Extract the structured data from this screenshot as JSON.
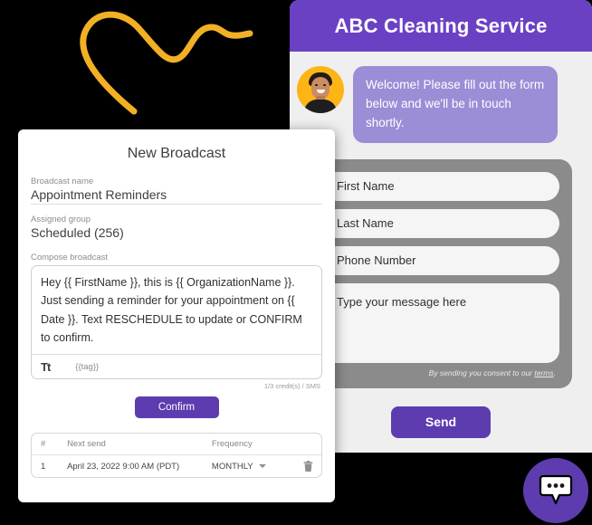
{
  "decor": {
    "squiggle_color": "#F2B024"
  },
  "chat_widget": {
    "header_title": "ABC Cleaning Service",
    "header_color": "#6B41C4",
    "welcome_message": "Welcome! Please fill out the form below and we'll be in touch shortly.",
    "bubble_color": "#9D8CD6",
    "avatar_bg": "#FDB515",
    "form": {
      "container_color": "#8B8B8B",
      "fields": [
        {
          "name": "first-name",
          "placeholder": "First Name"
        },
        {
          "name": "last-name",
          "placeholder": "Last Name"
        },
        {
          "name": "phone-number",
          "placeholder": "Phone Number"
        }
      ],
      "message_placeholder": "Type your message here",
      "consent_prefix": "By sending you consent to our ",
      "consent_link": "terms",
      "consent_suffix": "."
    },
    "send_label": "Send",
    "send_color": "#5D3CAF",
    "launcher_color": "#5D3CAF",
    "launcher_icon": "chat-bubble-icon"
  },
  "broadcast": {
    "title": "New Broadcast",
    "name_label": "Broadcast name",
    "name_value": "Appointment Reminders",
    "group_label": "Assigned group",
    "group_value": "Scheduled (256)",
    "compose_label": "Compose broadcast",
    "compose_value": "Hey {{ FirstName }}, this is {{ OrganizationName }}. Just sending a reminder for your appointment on {{ Date }}. Text RESCHEDULE to update or CONFIRM to confirm.",
    "toolbar": {
      "format_icon_label": "Tt",
      "tag_label": "{{tag}}"
    },
    "credit_text": "1/3 credit(s) / SMS",
    "confirm_label": "Confirm",
    "confirm_color": "#5D3CAF",
    "table": {
      "headers": [
        "#",
        "Next send",
        "Frequency"
      ],
      "rows": [
        {
          "num": "1",
          "next_send": "April 23, 2022 9:00 AM (PDT)",
          "frequency": "MONTHLY"
        }
      ]
    }
  }
}
